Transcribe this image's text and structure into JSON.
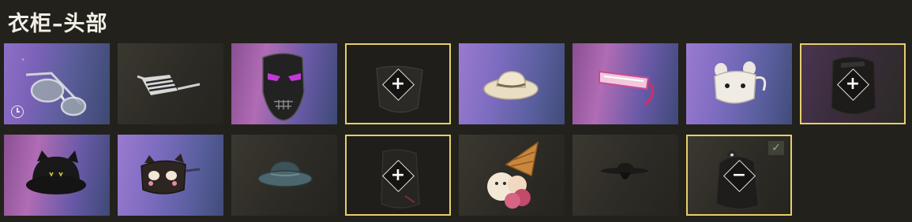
{
  "header": {
    "title": "衣柜–头部"
  },
  "icons": {
    "add": "plus-icon",
    "remove": "minus-icon",
    "timer": "clock-icon",
    "equipped": "checkmark-icon"
  },
  "colors": {
    "selection_border": "#e6cf6a",
    "background": "#23211c"
  },
  "symbols": {
    "add": "+",
    "remove": "−",
    "equipped": "✓"
  },
  "slots": [
    {
      "item": "aviator-sunglasses",
      "state": "owned",
      "timed": true
    },
    {
      "item": "shutter-shades",
      "state": "owned"
    },
    {
      "item": "black-skull-mask",
      "state": "owned"
    },
    {
      "item": "black-face-mask",
      "state": "empty-add"
    },
    {
      "item": "straw-sun-hat",
      "state": "owned"
    },
    {
      "item": "pink-visor-glasses",
      "state": "owned"
    },
    {
      "item": "bunny-face-mask",
      "state": "owned"
    },
    {
      "item": "black-balaclava",
      "state": "selected-add"
    },
    {
      "item": "black-cat-bucket-hat",
      "state": "owned"
    },
    {
      "item": "cat-sleep-mask",
      "state": "owned"
    },
    {
      "item": "teal-bucket-hat",
      "state": "owned"
    },
    {
      "item": "black-face-scarf",
      "state": "empty-add"
    },
    {
      "item": "ice-cream-headpiece",
      "state": "owned"
    },
    {
      "item": "black-wide-brim-hat",
      "state": "owned"
    },
    {
      "item": "black-hood",
      "state": "equipped-remove"
    }
  ]
}
